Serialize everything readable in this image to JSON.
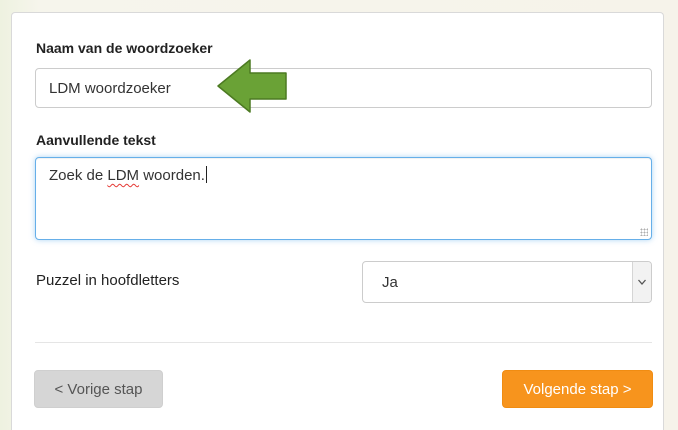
{
  "form": {
    "name_label": "Naam van de woordzoeker",
    "name_value": "LDM woordzoeker",
    "extra_text_label": "Aanvullende tekst",
    "extra_text_prefix": "Zoek de ",
    "extra_text_flagged": "LDM",
    "extra_text_suffix": " woorden.",
    "uppercase_label": "Puzzel in hoofdletters",
    "uppercase_value": "Ja"
  },
  "nav": {
    "prev_label": "< Vorige stap",
    "next_label": "Volgende stap >"
  },
  "colors": {
    "accent_orange": "#f7941d",
    "arrow_green": "#6aa236",
    "focus_blue": "#66afe9",
    "spell_red": "#e53935"
  },
  "icons": {
    "arrow": "arrow-left-icon",
    "select": "chevron-down-icon"
  }
}
